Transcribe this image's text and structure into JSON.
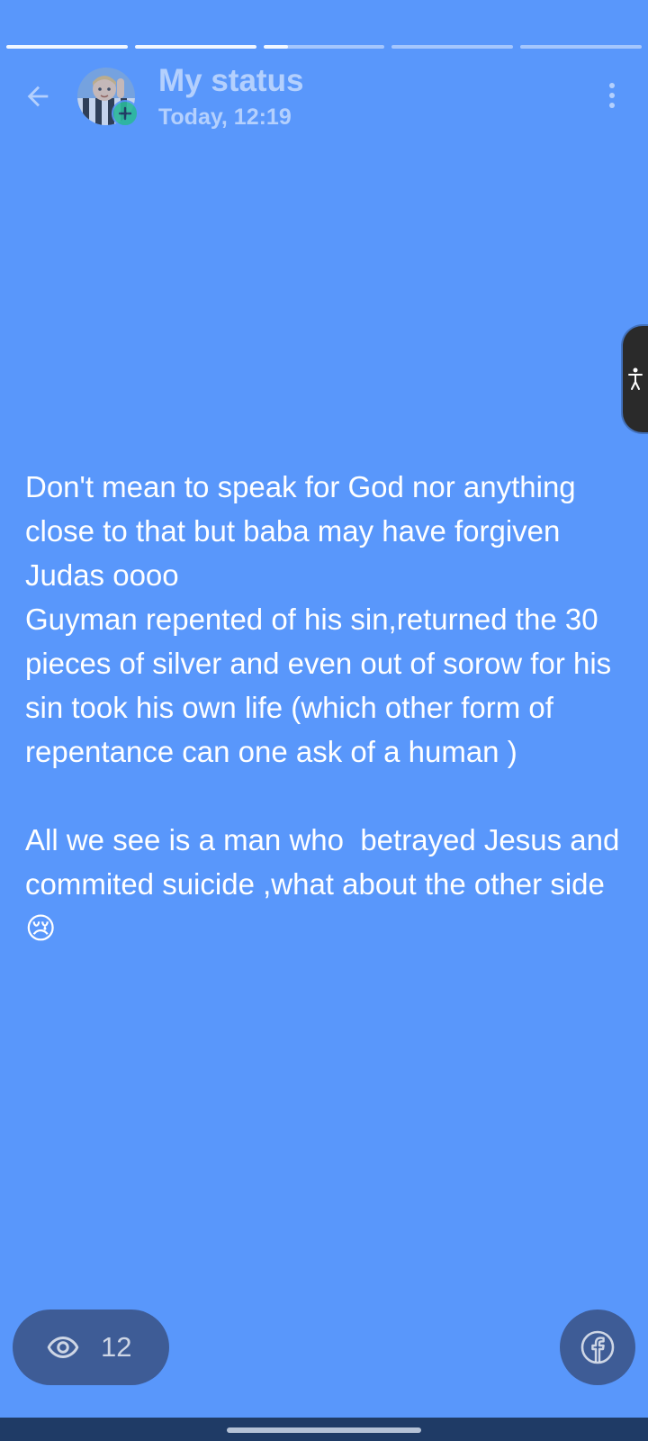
{
  "progress": {
    "segments": [
      1,
      1,
      0.2,
      0,
      0
    ]
  },
  "header": {
    "title": "My status",
    "time": "Today, 12:19"
  },
  "status": {
    "text": "Don't mean to speak for God nor anything close to that but baba may have forgiven Judas oooo\nGuyman repented of his sin,returned the 30 pieces of silver and even out of sorow for his sin took his own life (which other form of repentance can one ask of a human )\n\nAll we see is a man who  betrayed Jesus and commited suicide ,what about the other side 😢"
  },
  "footer": {
    "views_count": "12"
  },
  "icons": {
    "back": "arrow-back-icon",
    "more": "more-vertical-icon",
    "add": "plus-icon",
    "eye": "eye-icon",
    "share": "facebook-icon",
    "accessibility": "accessibility-icon"
  },
  "colors": {
    "background": "#5997fb",
    "pill": "#3e5c96",
    "add_badge": "#2bb89a",
    "navbar": "#1f3b66"
  }
}
